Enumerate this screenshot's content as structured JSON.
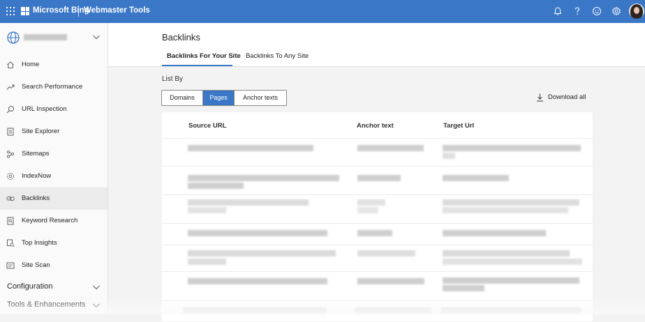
{
  "topbar": {
    "brand": "Microsoft Bing",
    "product": "Webmaster Tools",
    "icons": [
      "app-launcher-icon",
      "bell-icon",
      "help-icon",
      "feedback-smiley-icon",
      "settings-gear-icon",
      "avatar"
    ],
    "accent_color": "#3a77c7"
  },
  "sidebar": {
    "site_selector": {
      "value": ""
    },
    "items": [
      {
        "label": "Home",
        "icon": "home-icon"
      },
      {
        "label": "Search Performance",
        "icon": "trend-icon"
      },
      {
        "label": "URL Inspection",
        "icon": "search-icon"
      },
      {
        "label": "Site Explorer",
        "icon": "document-icon"
      },
      {
        "label": "Sitemaps",
        "icon": "sitemap-icon"
      },
      {
        "label": "IndexNow",
        "icon": "indexnow-gear-icon"
      },
      {
        "label": "Backlinks",
        "icon": "link-icon",
        "active": true
      },
      {
        "label": "Keyword Research",
        "icon": "keyword-doc-icon"
      },
      {
        "label": "Top Insights",
        "icon": "insights-icon"
      },
      {
        "label": "Site Scan",
        "icon": "scan-icon"
      }
    ],
    "groups": [
      {
        "label": "Configuration"
      },
      {
        "label": "Tools & Enhancements"
      }
    ]
  },
  "header": {
    "title": "Backlinks",
    "tabs": [
      {
        "label": "Backlinks For Your Site",
        "active": true
      },
      {
        "label": "Backlinks To Any Site",
        "active": false
      }
    ]
  },
  "content": {
    "list_by_label": "List By",
    "list_by_options": [
      {
        "label": "Domains",
        "selected": false
      },
      {
        "label": "Pages",
        "selected": true
      },
      {
        "label": "Anchor texts",
        "selected": false
      }
    ],
    "download_label": "Download all"
  },
  "table": {
    "columns": [
      "Source URL",
      "Anchor text",
      "Target Url"
    ],
    "rows_note_hidden": true
  }
}
